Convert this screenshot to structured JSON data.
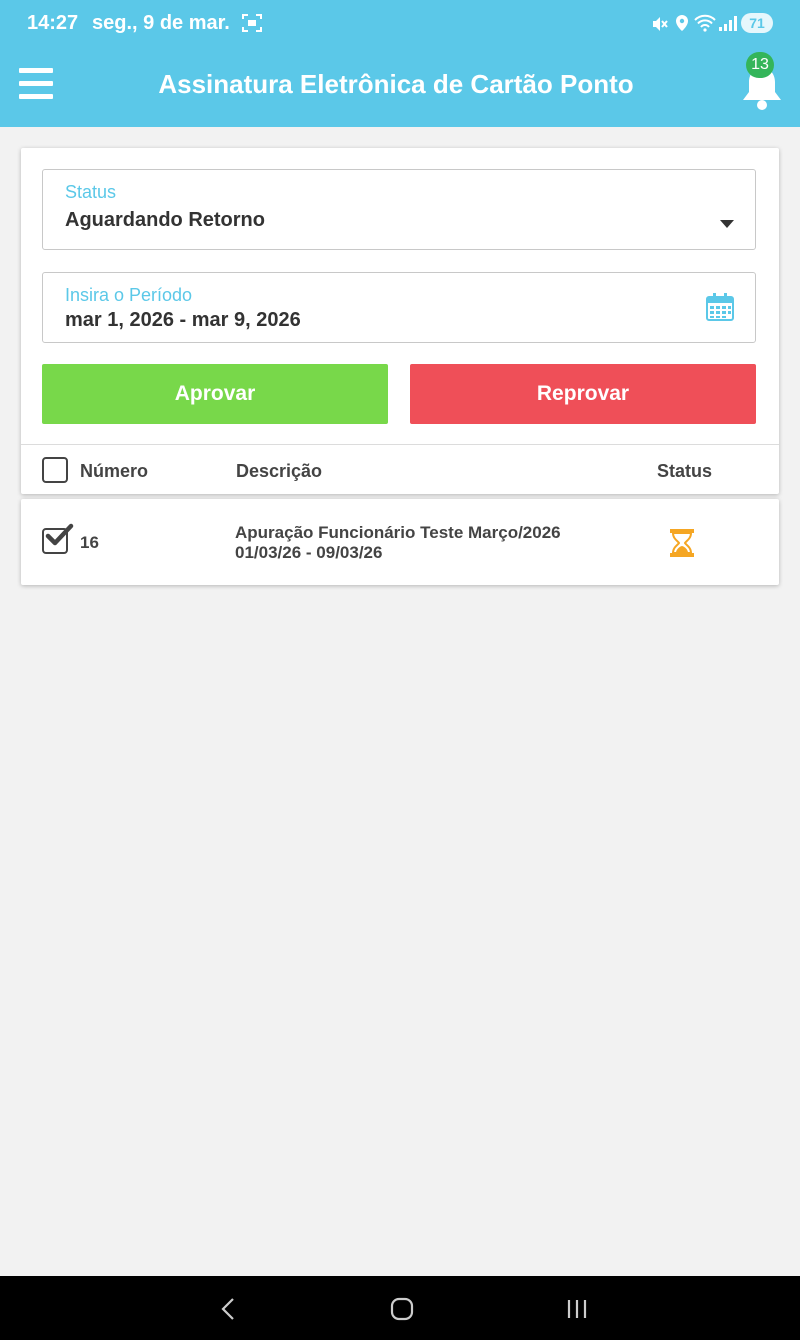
{
  "status_bar": {
    "time": "14:27",
    "date": "seg., 9 de mar.",
    "battery": "71"
  },
  "app_bar": {
    "title": "Assinatura Eletrônica de Cartão Ponto",
    "notification_count": "13"
  },
  "filters": {
    "status_label": "Status",
    "status_value": "Aguardando Retorno",
    "period_label": "Insira o Período",
    "period_value": "mar 1, 2026 - mar 9, 2026"
  },
  "actions": {
    "approve_label": "Aprovar",
    "reject_label": "Reprovar"
  },
  "table": {
    "headers": [
      "Número",
      "Descrição",
      "Status"
    ],
    "rows": [
      {
        "number": "16",
        "description_line1": "Apuração Funcionário Teste Março/2026",
        "description_line2": "01/03/26 - 09/03/26",
        "status_icon": "hourglass-icon",
        "checked": true
      }
    ]
  },
  "colors": {
    "primary": "#5bc8e8",
    "approve": "#78d84a",
    "reject": "#ef4f58",
    "badge": "#34b55a",
    "pending": "#f5a623"
  }
}
